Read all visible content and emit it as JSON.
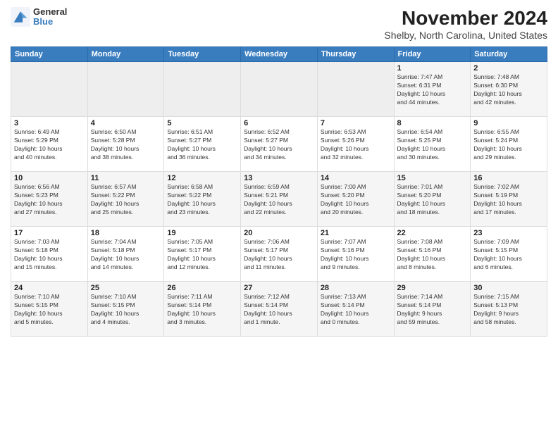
{
  "header": {
    "logo_general": "General",
    "logo_blue": "Blue",
    "month_title": "November 2024",
    "location": "Shelby, North Carolina, United States"
  },
  "weekdays": [
    "Sunday",
    "Monday",
    "Tuesday",
    "Wednesday",
    "Thursday",
    "Friday",
    "Saturday"
  ],
  "weeks": [
    [
      {
        "day": "",
        "info": ""
      },
      {
        "day": "",
        "info": ""
      },
      {
        "day": "",
        "info": ""
      },
      {
        "day": "",
        "info": ""
      },
      {
        "day": "",
        "info": ""
      },
      {
        "day": "1",
        "info": "Sunrise: 7:47 AM\nSunset: 6:31 PM\nDaylight: 10 hours\nand 44 minutes."
      },
      {
        "day": "2",
        "info": "Sunrise: 7:48 AM\nSunset: 6:30 PM\nDaylight: 10 hours\nand 42 minutes."
      }
    ],
    [
      {
        "day": "3",
        "info": "Sunrise: 6:49 AM\nSunset: 5:29 PM\nDaylight: 10 hours\nand 40 minutes."
      },
      {
        "day": "4",
        "info": "Sunrise: 6:50 AM\nSunset: 5:28 PM\nDaylight: 10 hours\nand 38 minutes."
      },
      {
        "day": "5",
        "info": "Sunrise: 6:51 AM\nSunset: 5:27 PM\nDaylight: 10 hours\nand 36 minutes."
      },
      {
        "day": "6",
        "info": "Sunrise: 6:52 AM\nSunset: 5:27 PM\nDaylight: 10 hours\nand 34 minutes."
      },
      {
        "day": "7",
        "info": "Sunrise: 6:53 AM\nSunset: 5:26 PM\nDaylight: 10 hours\nand 32 minutes."
      },
      {
        "day": "8",
        "info": "Sunrise: 6:54 AM\nSunset: 5:25 PM\nDaylight: 10 hours\nand 30 minutes."
      },
      {
        "day": "9",
        "info": "Sunrise: 6:55 AM\nSunset: 5:24 PM\nDaylight: 10 hours\nand 29 minutes."
      }
    ],
    [
      {
        "day": "10",
        "info": "Sunrise: 6:56 AM\nSunset: 5:23 PM\nDaylight: 10 hours\nand 27 minutes."
      },
      {
        "day": "11",
        "info": "Sunrise: 6:57 AM\nSunset: 5:22 PM\nDaylight: 10 hours\nand 25 minutes."
      },
      {
        "day": "12",
        "info": "Sunrise: 6:58 AM\nSunset: 5:22 PM\nDaylight: 10 hours\nand 23 minutes."
      },
      {
        "day": "13",
        "info": "Sunrise: 6:59 AM\nSunset: 5:21 PM\nDaylight: 10 hours\nand 22 minutes."
      },
      {
        "day": "14",
        "info": "Sunrise: 7:00 AM\nSunset: 5:20 PM\nDaylight: 10 hours\nand 20 minutes."
      },
      {
        "day": "15",
        "info": "Sunrise: 7:01 AM\nSunset: 5:20 PM\nDaylight: 10 hours\nand 18 minutes."
      },
      {
        "day": "16",
        "info": "Sunrise: 7:02 AM\nSunset: 5:19 PM\nDaylight: 10 hours\nand 17 minutes."
      }
    ],
    [
      {
        "day": "17",
        "info": "Sunrise: 7:03 AM\nSunset: 5:18 PM\nDaylight: 10 hours\nand 15 minutes."
      },
      {
        "day": "18",
        "info": "Sunrise: 7:04 AM\nSunset: 5:18 PM\nDaylight: 10 hours\nand 14 minutes."
      },
      {
        "day": "19",
        "info": "Sunrise: 7:05 AM\nSunset: 5:17 PM\nDaylight: 10 hours\nand 12 minutes."
      },
      {
        "day": "20",
        "info": "Sunrise: 7:06 AM\nSunset: 5:17 PM\nDaylight: 10 hours\nand 11 minutes."
      },
      {
        "day": "21",
        "info": "Sunrise: 7:07 AM\nSunset: 5:16 PM\nDaylight: 10 hours\nand 9 minutes."
      },
      {
        "day": "22",
        "info": "Sunrise: 7:08 AM\nSunset: 5:16 PM\nDaylight: 10 hours\nand 8 minutes."
      },
      {
        "day": "23",
        "info": "Sunrise: 7:09 AM\nSunset: 5:15 PM\nDaylight: 10 hours\nand 6 minutes."
      }
    ],
    [
      {
        "day": "24",
        "info": "Sunrise: 7:10 AM\nSunset: 5:15 PM\nDaylight: 10 hours\nand 5 minutes."
      },
      {
        "day": "25",
        "info": "Sunrise: 7:10 AM\nSunset: 5:15 PM\nDaylight: 10 hours\nand 4 minutes."
      },
      {
        "day": "26",
        "info": "Sunrise: 7:11 AM\nSunset: 5:14 PM\nDaylight: 10 hours\nand 3 minutes."
      },
      {
        "day": "27",
        "info": "Sunrise: 7:12 AM\nSunset: 5:14 PM\nDaylight: 10 hours\nand 1 minute."
      },
      {
        "day": "28",
        "info": "Sunrise: 7:13 AM\nSunset: 5:14 PM\nDaylight: 10 hours\nand 0 minutes."
      },
      {
        "day": "29",
        "info": "Sunrise: 7:14 AM\nSunset: 5:14 PM\nDaylight: 9 hours\nand 59 minutes."
      },
      {
        "day": "30",
        "info": "Sunrise: 7:15 AM\nSunset: 5:13 PM\nDaylight: 9 hours\nand 58 minutes."
      }
    ]
  ]
}
